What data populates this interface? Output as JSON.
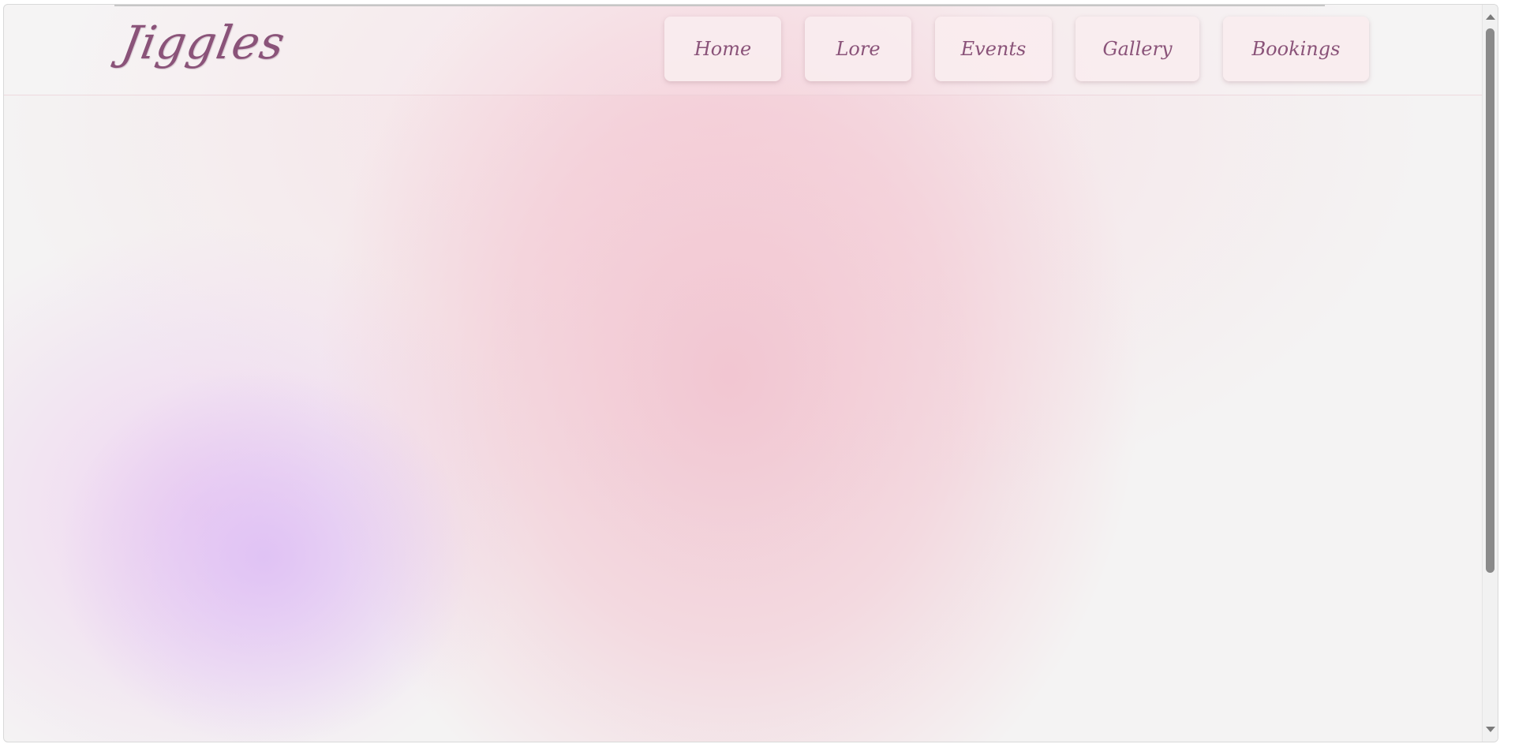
{
  "site": {
    "logo": "Jiggles"
  },
  "nav": {
    "items": [
      {
        "label": "Home"
      },
      {
        "label": "Lore"
      },
      {
        "label": "Events"
      },
      {
        "label": "Gallery"
      },
      {
        "label": "Bookings"
      }
    ]
  },
  "colors": {
    "brand_text": "#8a5379",
    "button_bg": "#faecee",
    "page_pink": "#f2c4d0",
    "page_lavender": "#ddbef5"
  },
  "scrollbar": {
    "position": 0.0
  }
}
